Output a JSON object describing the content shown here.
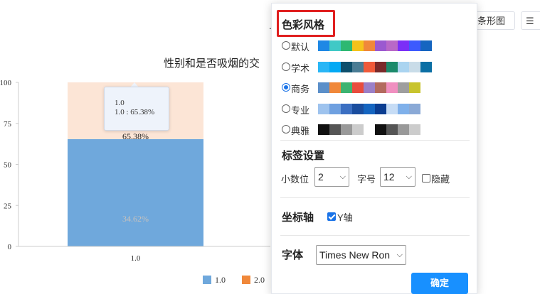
{
  "toolbar": {
    "bar_chart_label": "条形图",
    "dot_label": "."
  },
  "chart_data": {
    "type": "bar",
    "title": "性别和是否吸烟的交",
    "categories": [
      "1.0"
    ],
    "series": [
      {
        "name": "1.0",
        "values": [
          65.38
        ],
        "color": "#6fa8dc"
      },
      {
        "name": "2.0",
        "values": [
          34.62
        ],
        "color": "#fce5d6"
      }
    ],
    "data_labels": [
      "65.38%",
      "34.62%"
    ],
    "y_ticks": [
      "0",
      "25",
      "50",
      "75",
      "100"
    ],
    "ylim": [
      0,
      100
    ],
    "stacked": true,
    "legend_position": "bottom"
  },
  "tooltip": {
    "line1": "1.0",
    "line2": "1.0 : 65.38%"
  },
  "panel": {
    "color_style_title": "色彩风格",
    "palettes": [
      {
        "label": "默认",
        "checked": false,
        "colors": [
          "#1e88e5",
          "#40c9c6",
          "#2eb872",
          "#f5c21b",
          "#f0883a",
          "#9b59d0",
          "#b968c7",
          "#7b2ff7",
          "#3d5afe",
          "#1565c0"
        ]
      },
      {
        "label": "学术",
        "checked": false,
        "colors": [
          "#29b6f6",
          "#03a9f4",
          "#0d4f6c",
          "#4a7c94",
          "#f05a3a",
          "#7a2a2a",
          "#1b8a6b",
          "#aad4f0",
          "#c9dce8",
          "#0b6fa4"
        ]
      },
      {
        "label": "商务",
        "checked": true,
        "colors": [
          "#5b8fc9",
          "#f0883a",
          "#3cb371",
          "#e84c3d",
          "#9b7fc7",
          "#b36a5e",
          "#f08fc0",
          "#9e9e9e",
          "#c8c42e",
          "#ffffff"
        ]
      },
      {
        "label": "专业",
        "checked": false,
        "colors": [
          "#9ec3ee",
          "#6fa0e0",
          "#3b6fc2",
          "#1a4d9e",
          "#1565c0",
          "#0b3d91",
          "#c6dcf5",
          "#7fb0ea",
          "#8aa9d6",
          "#ffffff"
        ]
      },
      {
        "label": "典雅",
        "checked": false,
        "colors": [
          "#111111",
          "#555555",
          "#999999",
          "#cccccc",
          "#ffffff",
          "#111111",
          "#555555",
          "#999999",
          "#cccccc",
          "#ffffff"
        ]
      }
    ],
    "label_settings_title": "标签设置",
    "decimal_label": "小数位",
    "decimal_value": "2",
    "font_size_label": "字号",
    "font_size_value": "12",
    "hide_label": "隐藏",
    "hide_checked": false,
    "axis_title": "坐标轴",
    "y_axis_label": "Y轴",
    "y_axis_checked": true,
    "font_title": "字体",
    "font_value": "Times New Ron",
    "confirm_label": "确定"
  }
}
